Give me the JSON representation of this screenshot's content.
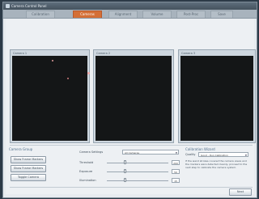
{
  "window": {
    "title": "Camera Control Panel"
  },
  "tabs": [
    {
      "label": "Calibration"
    },
    {
      "label": "Cameras"
    },
    {
      "label": "Alignment"
    },
    {
      "label": "Volume"
    },
    {
      "label": "Post-Proc"
    },
    {
      "label": "Save"
    }
  ],
  "cameras": [
    {
      "label": "Camera 1"
    },
    {
      "label": "Camera 2"
    },
    {
      "label": "Camera 3"
    }
  ],
  "camera_group": {
    "title": "Camera Group",
    "buttons": [
      "Show Frame Markers",
      "Show Frame Markers",
      "Toggle Camera"
    ]
  },
  "settings": {
    "title": "Camera Settings",
    "mode_label": "Camera Settings",
    "mode_value": "All Cameras",
    "threshold_label": "Threshold",
    "threshold_value": "200",
    "exposure_label": "Exposure",
    "exposure_value": "50",
    "illumination_label": "Illumination",
    "illumination_value": "15"
  },
  "calibration": {
    "title": "Calibration Wizard",
    "quality_label": "Quality",
    "quality_value": "Good - Run Calibration",
    "description": "If the wand strokes covered the camera views and the markers were detected cleanly, proceed to the next step to calibrate the camera system."
  },
  "footer": {
    "next_label": "Next"
  }
}
